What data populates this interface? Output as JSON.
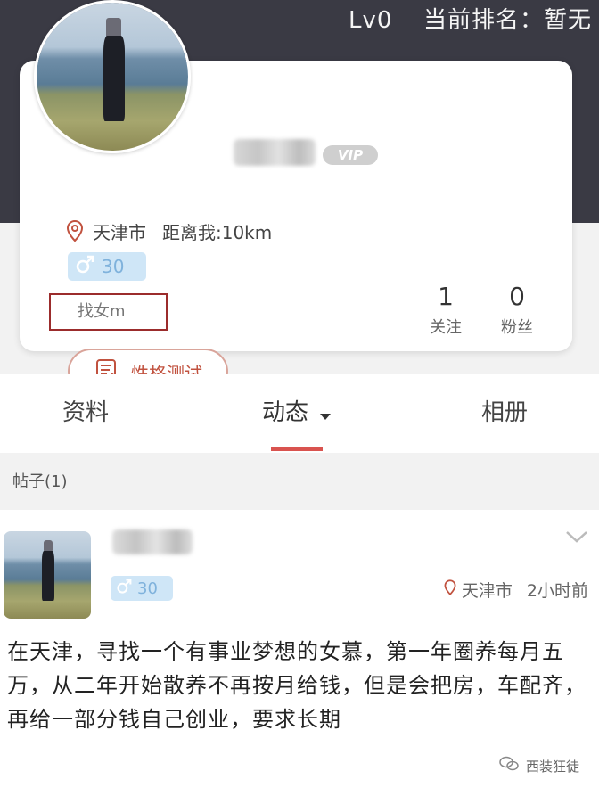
{
  "header": {
    "level": "Lv0",
    "rank_text": "当前排名：暂无"
  },
  "profile": {
    "vip_label": "VIP",
    "city": "天津市",
    "distance": "距离我:10km",
    "age": "30",
    "tag": "找女m",
    "persona_button": "性格测试",
    "following_count": "1",
    "following_label": "关注",
    "followers_count": "0",
    "followers_label": "粉丝"
  },
  "tabs": [
    {
      "label": "资料"
    },
    {
      "label": "动态"
    },
    {
      "label": "相册"
    }
  ],
  "section": {
    "label": "帖子(1)"
  },
  "post": {
    "age": "30",
    "city": "天津市",
    "time": "2小时前",
    "text": "在天津，寻找一个有事业梦想的女慕，第一年圈养每月五万，从二年开始散养不再按月给钱，但是会把房，车配齐，再给一部分钱自己创业，要求长期"
  },
  "watermark": {
    "text": "西装狂徒"
  },
  "colors": {
    "header_bg": "#3a3a44",
    "accent_red": "#d9534f",
    "male_badge_bg": "#cfe6f7",
    "male_badge_fg": "#7fb2dc"
  }
}
